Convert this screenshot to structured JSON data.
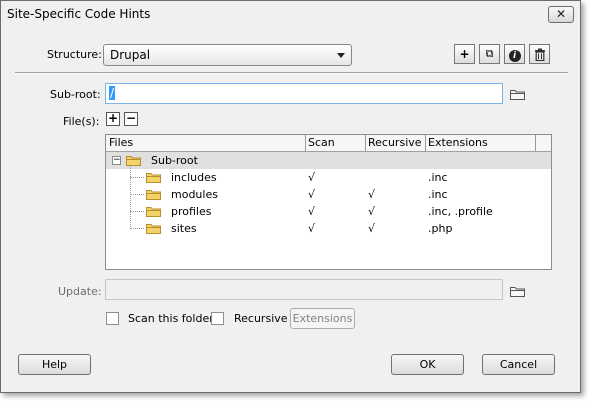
{
  "window": {
    "title": "Site-Specific Code Hints",
    "close_glyph": "✕"
  },
  "structure": {
    "label": "Structure:",
    "selected": "Drupal",
    "toolbar": {
      "add": "+",
      "add_file": "⧉",
      "info": "i",
      "delete": "🗑"
    }
  },
  "subroot": {
    "label": "Sub-root:",
    "value": "/"
  },
  "files": {
    "label": "File(s):",
    "add": "+",
    "remove": "−"
  },
  "table": {
    "columns": [
      "Files",
      "Scan",
      "Recursive",
      "Extensions"
    ],
    "root": {
      "expander": "−",
      "name": "Sub-root"
    },
    "rows": [
      {
        "name": "includes",
        "scan": "√",
        "recursive": "",
        "extensions": ".inc"
      },
      {
        "name": "modules",
        "scan": "√",
        "recursive": "√",
        "extensions": ".inc"
      },
      {
        "name": "profiles",
        "scan": "√",
        "recursive": "√",
        "extensions": ".inc, .profile"
      },
      {
        "name": "sites",
        "scan": "√",
        "recursive": "√",
        "extensions": ".php"
      }
    ]
  },
  "update": {
    "label": "Update:",
    "value": "",
    "scan_this_folder": "Scan this folder",
    "recursive": "Recursive",
    "extensions_button": "Extensions"
  },
  "buttons": {
    "help": "Help",
    "ok": "OK",
    "cancel": "Cancel"
  },
  "colors": {
    "folder": "#f3d26a",
    "folder_edge": "#b8902b",
    "selected_row": "#e0e0e0",
    "accent": "#3399ff"
  }
}
